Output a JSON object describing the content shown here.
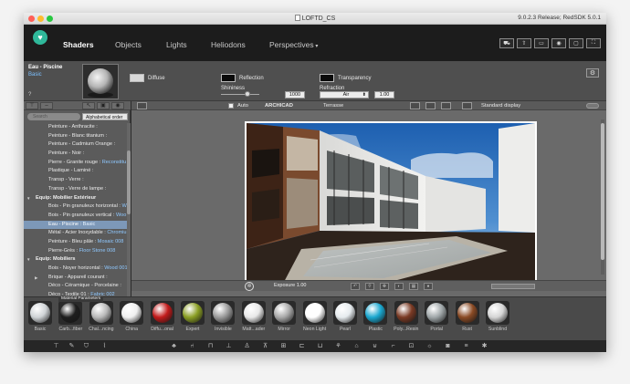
{
  "window": {
    "title": "LOFTD_CS",
    "version": "9.0.2.3 Release; RedSDK 5.0.1"
  },
  "nav": {
    "tabs": [
      "Shaders",
      "Objects",
      "Lights",
      "Heliodons",
      "Perspectives"
    ]
  },
  "editor": {
    "material_name": "Eau - Piscine",
    "material_type": "Basic",
    "help": "?",
    "diffuse_label": "Diffuse",
    "reflection_label": "Reflection",
    "shininess_label": "Shininess",
    "shininess_value": "1000",
    "transparency_label": "Transparency",
    "refraction_label": "Refraction",
    "refraction_medium": "Air",
    "refraction_value": "1.00",
    "shininess_level": 0.7
  },
  "sidebar": {
    "search_placeholder": "Search",
    "sort_label": "Alphabetical order",
    "items": [
      {
        "text": "Peinture - Anthracite :",
        "value": "",
        "kind": "item"
      },
      {
        "text": "Peinture - Blanc titanium :",
        "value": "",
        "kind": "item"
      },
      {
        "text": "Peinture - Cadmium Orange :",
        "value": "",
        "kind": "item"
      },
      {
        "text": "Peinture - Noir :",
        "value": "",
        "kind": "item"
      },
      {
        "text": "Pierre - Granite rouge : ",
        "value": "Reconstitu",
        "kind": "item"
      },
      {
        "text": "Plastique - Laminé :",
        "value": "",
        "kind": "item"
      },
      {
        "text": "Transp - Verre :",
        "value": "",
        "kind": "item"
      },
      {
        "text": "Transp - Verre de lampe :",
        "value": "",
        "kind": "item"
      },
      {
        "text": "Equip: Mobilier Extérieur",
        "value": "",
        "kind": "group"
      },
      {
        "text": "Bois - Pin granuleux horizontal : ",
        "value": "W",
        "kind": "item"
      },
      {
        "text": "Bois - Pin granuleux vertical : ",
        "value": "Woo",
        "kind": "item"
      },
      {
        "text": "Eau - Piscine : ",
        "value": "Basic",
        "kind": "selected"
      },
      {
        "text": "Métal - Acier Inoxydable : ",
        "value": "Chromiu",
        "kind": "item"
      },
      {
        "text": "Peinture - Bleu pâle : ",
        "value": "Mosaic 008",
        "kind": "item"
      },
      {
        "text": "Pierre-Grès : ",
        "value": "Floor Stone 008",
        "kind": "item"
      },
      {
        "text": "Equip: Mobiliers",
        "value": "",
        "kind": "group"
      },
      {
        "text": "Bois - Noyer horizontal : ",
        "value": "Wood 001",
        "kind": "item"
      },
      {
        "text": "Brique - Appareil courant :",
        "value": "",
        "kind": "sub"
      },
      {
        "text": "Déco - Céramique - Porcelaine :",
        "value": "",
        "kind": "item"
      },
      {
        "text": "Déco - Textile 01 : ",
        "value": "Fabric 002",
        "kind": "item"
      }
    ]
  },
  "viewport": {
    "auto_label": "Auto",
    "engine": "ARCHICAD",
    "scene": "Terrasse",
    "display_mode": "Standard display",
    "exposure": "Exposure 1.00"
  },
  "palette": {
    "title": "Material Parameters",
    "materials": [
      {
        "name": "Basic",
        "color": "#cfd3d6"
      },
      {
        "name": "Carb...fiber",
        "color": "#1e1e1e"
      },
      {
        "name": "Chal...ncing",
        "color": "#b9b9b9"
      },
      {
        "name": "China",
        "color": "#efefef"
      },
      {
        "name": "Diffu...onal",
        "color": "#c21a1a"
      },
      {
        "name": "Expert",
        "color": "#8a9e23"
      },
      {
        "name": "Invisible",
        "color": "#9a9a9a"
      },
      {
        "name": "Matt...ader",
        "color": "#e8e8e8"
      },
      {
        "name": "Mirror",
        "color": "#a8a8a8"
      },
      {
        "name": "Neon Light",
        "color": "#ffffff"
      },
      {
        "name": "Pearl",
        "color": "#e6ebee"
      },
      {
        "name": "Plastic",
        "color": "#1aa7cf"
      },
      {
        "name": "Poly...Resin",
        "color": "#7a3a24"
      },
      {
        "name": "Portal",
        "color": "#9fa6a8"
      },
      {
        "name": "Rust",
        "color": "#8a4a24"
      },
      {
        "name": "Sunblind",
        "color": "#d5d5d5"
      }
    ]
  }
}
